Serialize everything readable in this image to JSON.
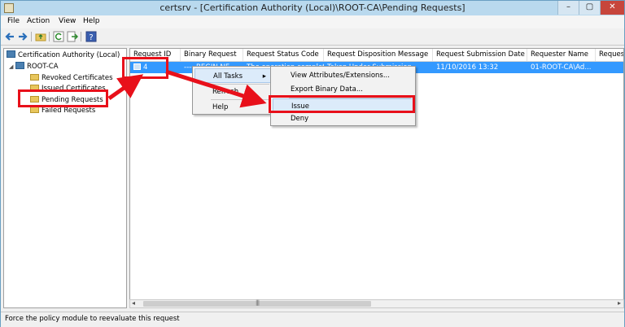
{
  "window": {
    "title": "certsrv - [Certification Authority (Local)\\ROOT-CA\\Pending Requests]"
  },
  "menu": {
    "file": "File",
    "action": "Action",
    "view": "View",
    "help": "Help"
  },
  "titlebar_buttons": {
    "minimize": "–",
    "maximize": "▢",
    "close": "✕"
  },
  "tree": {
    "root": "Certification Authority (Local)",
    "ca": "ROOT-CA",
    "items": [
      "Revoked Certificates",
      "Issued Certificates",
      "Pending Requests",
      "Failed Requests"
    ]
  },
  "list": {
    "columns": [
      "Request ID",
      "Binary Request",
      "Request Status Code",
      "Request Disposition Message",
      "Request Submission Date",
      "Requester Name",
      "Reques"
    ],
    "rows": [
      {
        "id": "4",
        "binary": "-----BEGIN NE...",
        "status": "The operation completed...",
        "disposition": "Taken Under Submission",
        "date": "11/10/2016 13:32",
        "requester": "01-ROOT-CA\\Ad...",
        "extra": ""
      }
    ]
  },
  "context_menu": {
    "all_tasks": "All Tasks",
    "refresh": "Refresh",
    "help": "Help",
    "submenu_arrow": "▸"
  },
  "submenu": {
    "view_attributes": "View Attributes/Extensions...",
    "export_binary": "Export Binary Data...",
    "issue": "Issue",
    "deny": "Deny"
  },
  "scrollbar": {
    "left": "◂",
    "right": "▸",
    "grip": "|||"
  },
  "status": {
    "text": "Force the policy module to reevaluate this request"
  },
  "colors": {
    "highlight": "#e8101a",
    "selection": "#3399ff",
    "titlebar": "#b9d9ee"
  }
}
